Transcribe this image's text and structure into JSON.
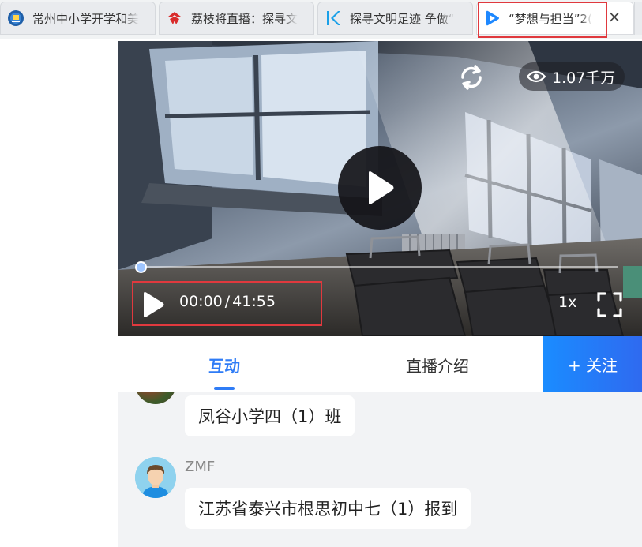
{
  "browser_tabs": [
    {
      "title": "常州中小学开学和美",
      "icon": "school-badge-icon"
    },
    {
      "title": "荔枝将直播：探寻文",
      "icon": "litchi-news-icon"
    },
    {
      "title": "探寻文明足迹 争做“",
      "icon": "k-logo-icon"
    },
    {
      "title": "“梦想与担当”2(",
      "icon": "play-logo-icon",
      "active": true
    }
  ],
  "player": {
    "view_count": "1.07千万",
    "time_current": "00:00",
    "time_separator": "/",
    "time_total": "41:55",
    "speed": "1x",
    "progress_fraction": 0
  },
  "tabs": {
    "interact": "互动",
    "intro": "直播介绍",
    "follow": "+ 关注"
  },
  "chat": {
    "messages": [
      {
        "user": "",
        "text": "凤谷小学四（1）班"
      },
      {
        "user": "ZMF",
        "text": "江苏省泰兴市根思初中七（1）报到"
      }
    ]
  },
  "colors": {
    "accent": "#2f7cf6",
    "follow_button": "#1a8cff",
    "highlight_box": "#e0393e",
    "chat_background": "#f2f3f5"
  }
}
